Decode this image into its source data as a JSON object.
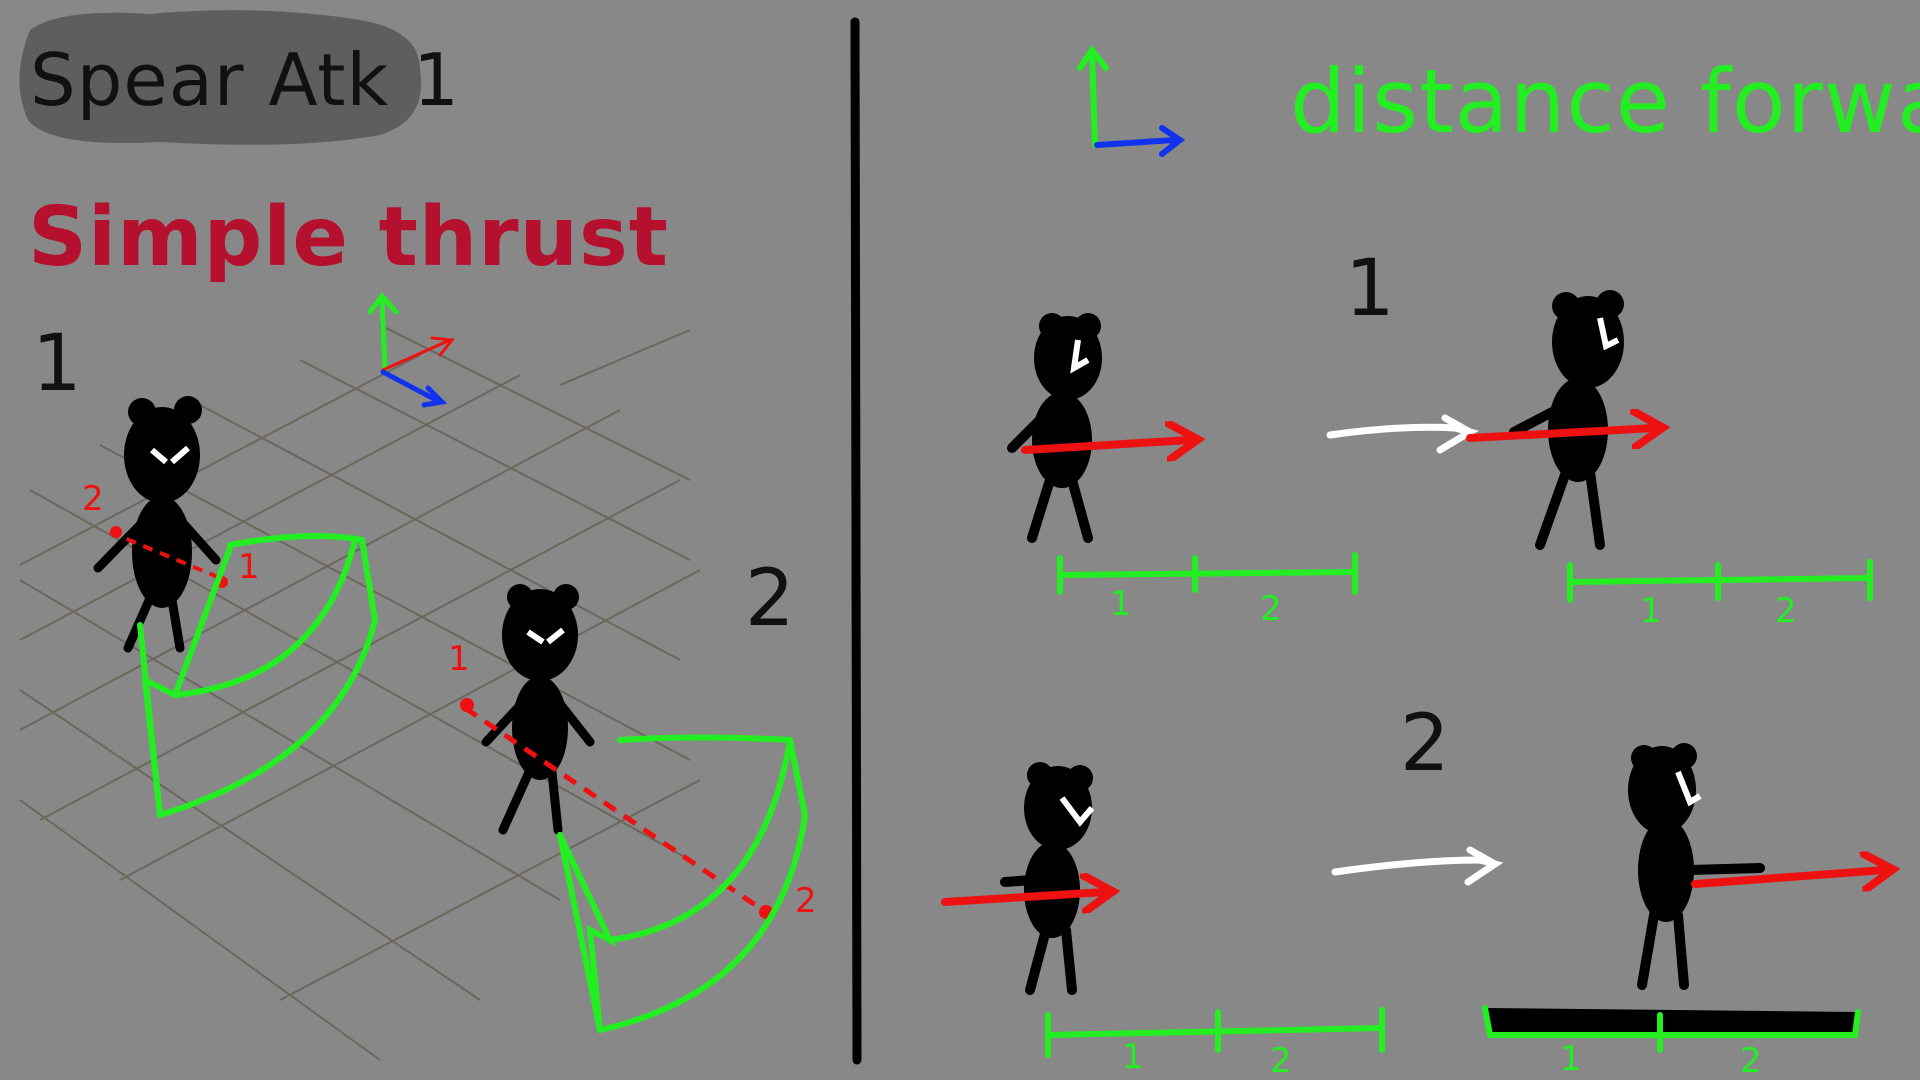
{
  "title": "Spear Atk 1",
  "subtitle": "Simple thrust",
  "right_heading": "distance forward",
  "left_labels": {
    "pose_1": "1",
    "pose_2": "2",
    "red_point_a1": "2",
    "red_point_a2": "1",
    "red_point_b1": "1",
    "red_point_b2": "2"
  },
  "right_labels": {
    "row_1": "1",
    "row_2": "2",
    "ruler_1": "1",
    "ruler_2": "2"
  },
  "colors": {
    "background": "#888888",
    "title_box": "#5e5e5e",
    "subtitle": "#b5102e",
    "green": "#22ee22",
    "red": "#ee1111",
    "blue": "#1133ee",
    "figure": "#000000",
    "arrow_white": "#ffffff",
    "grid": "#6a6458"
  },
  "icons": {
    "axis_gizmo_left": "xyz-axis-icon",
    "axis_gizmo_right": "xy-axis-icon",
    "motion_arrow": "arrow-right-icon"
  }
}
